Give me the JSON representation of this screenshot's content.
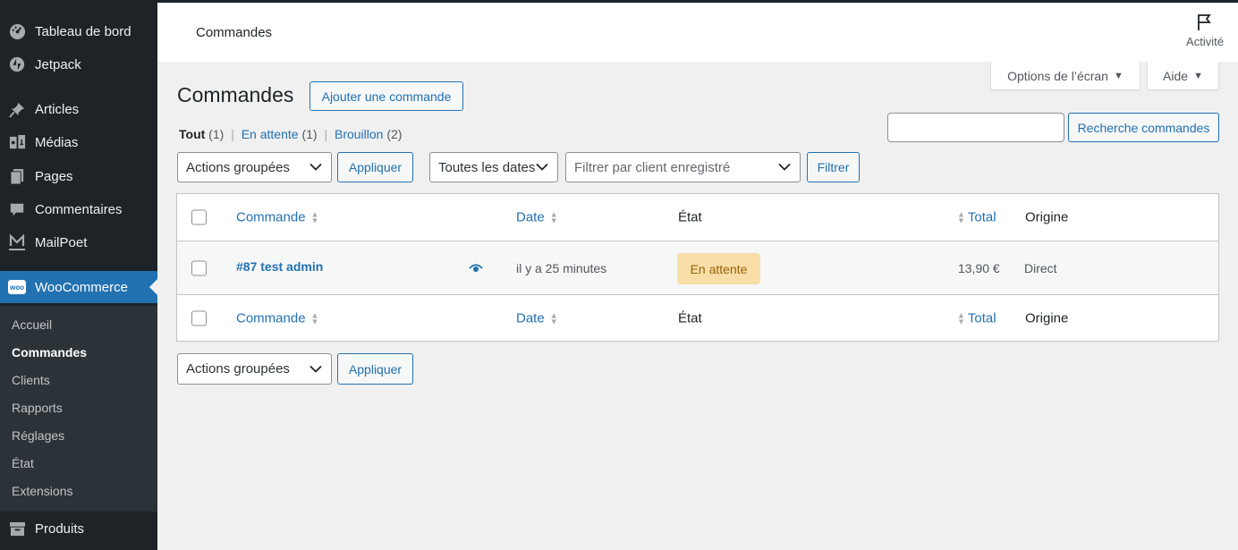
{
  "sidebar": {
    "items": [
      {
        "label": "Tableau de bord",
        "icon": "dashboard-icon"
      },
      {
        "label": "Jetpack",
        "icon": "jetpack-icon"
      },
      {
        "label": "Articles",
        "icon": "pin-icon"
      },
      {
        "label": "Médias",
        "icon": "media-icon"
      },
      {
        "label": "Pages",
        "icon": "pages-icon"
      },
      {
        "label": "Commentaires",
        "icon": "comments-icon"
      },
      {
        "label": "MailPoet",
        "icon": "mailpoet-icon"
      },
      {
        "label": "WooCommerce",
        "icon": "woocommerce-icon",
        "icon_text": "woo"
      },
      {
        "label": "Produits",
        "icon": "products-icon"
      }
    ],
    "submenu": [
      "Accueil",
      "Commandes",
      "Clients",
      "Rapports",
      "Réglages",
      "État",
      "Extensions"
    ]
  },
  "topbar": {
    "title": "Commandes",
    "activity_label": "Activité"
  },
  "screen_options": {
    "options_label": "Options de l’écran",
    "help_label": "Aide",
    "arrow": "▼"
  },
  "header": {
    "title": "Commandes",
    "add_button": "Ajouter une commande"
  },
  "filters_links": {
    "all_label": "Tout",
    "all_count": "(1)",
    "pending_label": "En attente",
    "pending_count": "(1)",
    "draft_label": "Brouillon",
    "draft_count": "(2)",
    "separator": "|"
  },
  "search": {
    "value": "",
    "button": "Recherche commandes"
  },
  "toolbar": {
    "bulk_actions": "Actions groupées",
    "apply": "Appliquer",
    "dates": "Toutes les dates",
    "customer_placeholder": "Filtrer par client enregistré",
    "filter": "Filtrer"
  },
  "table": {
    "columns": {
      "order": "Commande",
      "date": "Date",
      "status": "État",
      "total": "Total",
      "origin": "Origine"
    },
    "rows": [
      {
        "order": "#87 test admin",
        "date": "il y a 25 minutes",
        "status": "En attente",
        "total": "13,90 €",
        "origin": "Direct"
      }
    ]
  },
  "colors": {
    "accent": "#2271b1",
    "sidebar_bg": "#1d2327",
    "status_pending_bg": "#f8dda7",
    "status_pending_text": "#94660c"
  }
}
